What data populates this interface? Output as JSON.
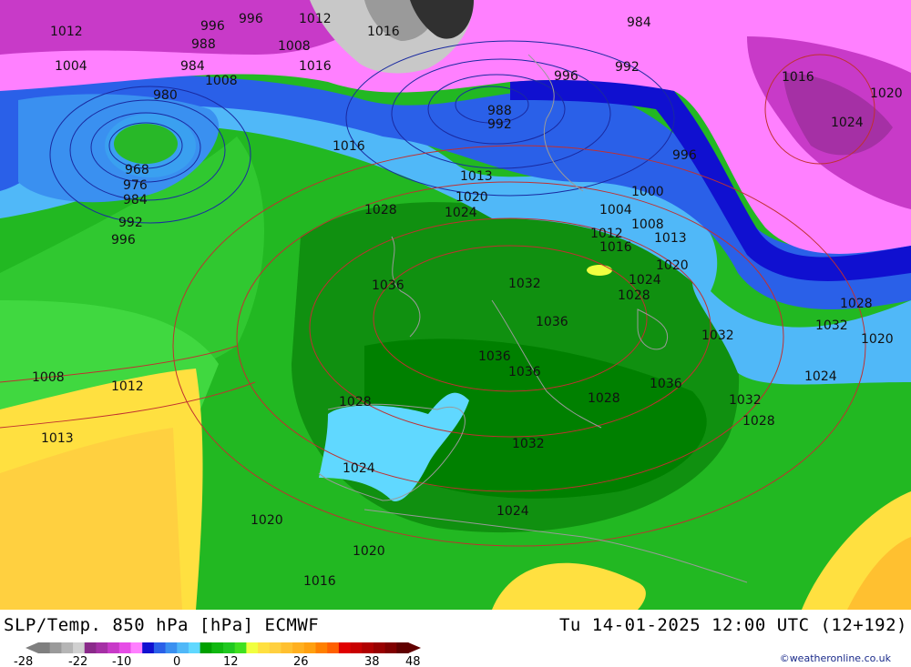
{
  "header": {
    "product": "SLP/Temp. 850 hPa [hPa] ECMWF",
    "datetime": "Tu 14-01-2025 12:00 UTC (12+192)"
  },
  "credit": "©weatheronline.co.uk",
  "colorbar": {
    "labels": [
      "-28",
      "-22",
      "-10",
      "0",
      "12",
      "26",
      "38",
      "48"
    ],
    "colors": [
      "#7f7f7f",
      "#9a9a9a",
      "#b5b5b5",
      "#d0d0d0",
      "#8a2a8a",
      "#a530a5",
      "#c83ac8",
      "#e64de6",
      "#ff80ff",
      "#1010d0",
      "#2a60e8",
      "#3a90f0",
      "#50b8f8",
      "#60d8ff",
      "#00a000",
      "#10b810",
      "#20c820",
      "#40e020",
      "#f0ff40",
      "#ffe040",
      "#ffd040",
      "#ffc030",
      "#ffb020",
      "#ffa010",
      "#ff8000",
      "#ff6000",
      "#e00000",
      "#c80000",
      "#b00000",
      "#980000",
      "#800000",
      "#600000"
    ]
  },
  "isobars": [
    {
      "text": "1012"
    },
    {
      "text": "996"
    },
    {
      "text": "996"
    },
    {
      "text": "1012"
    },
    {
      "text": "1016"
    },
    {
      "text": "984"
    },
    {
      "text": "1004"
    },
    {
      "text": "988"
    },
    {
      "text": "1008"
    },
    {
      "text": "984"
    },
    {
      "text": "1016"
    },
    {
      "text": "980"
    },
    {
      "text": "1008"
    },
    {
      "text": "996"
    },
    {
      "text": "992"
    },
    {
      "text": "1016"
    },
    {
      "text": "1020"
    },
    {
      "text": "988"
    },
    {
      "text": "992"
    },
    {
      "text": "1024"
    },
    {
      "text": "1016"
    },
    {
      "text": "968"
    },
    {
      "text": "976"
    },
    {
      "text": "984"
    },
    {
      "text": "992"
    },
    {
      "text": "996"
    },
    {
      "text": "996"
    },
    {
      "text": "1013"
    },
    {
      "text": "1020"
    },
    {
      "text": "1024"
    },
    {
      "text": "1028"
    },
    {
      "text": "1000"
    },
    {
      "text": "1004"
    },
    {
      "text": "1008"
    },
    {
      "text": "1012"
    },
    {
      "text": "1013"
    },
    {
      "text": "1016"
    },
    {
      "text": "1020"
    },
    {
      "text": "1024"
    },
    {
      "text": "1032"
    },
    {
      "text": "1036"
    },
    {
      "text": "1028"
    },
    {
      "text": "1028"
    },
    {
      "text": "1032"
    },
    {
      "text": "1020"
    },
    {
      "text": "1036"
    },
    {
      "text": "1032"
    },
    {
      "text": "1036"
    },
    {
      "text": "1036"
    },
    {
      "text": "1036"
    },
    {
      "text": "1008"
    },
    {
      "text": "1012"
    },
    {
      "text": "1024"
    },
    {
      "text": "1032"
    },
    {
      "text": "1028"
    },
    {
      "text": "1028"
    },
    {
      "text": "1028"
    },
    {
      "text": "1032"
    },
    {
      "text": "1013"
    },
    {
      "text": "1024"
    },
    {
      "text": "1020"
    },
    {
      "text": "1024"
    },
    {
      "text": "1020"
    },
    {
      "text": "1016"
    }
  ]
}
